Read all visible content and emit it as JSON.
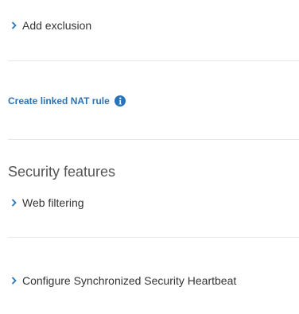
{
  "exclusion": {
    "label": "Add exclusion",
    "icon": "chevron-right-icon"
  },
  "nat": {
    "link_label": "Create linked NAT rule",
    "info_icon": "info-icon",
    "link_color": "#2a73b8"
  },
  "security": {
    "title": "Security features",
    "web_filtering_label": "Web filtering",
    "heartbeat_label": "Configure Synchronized Security Heartbeat"
  }
}
